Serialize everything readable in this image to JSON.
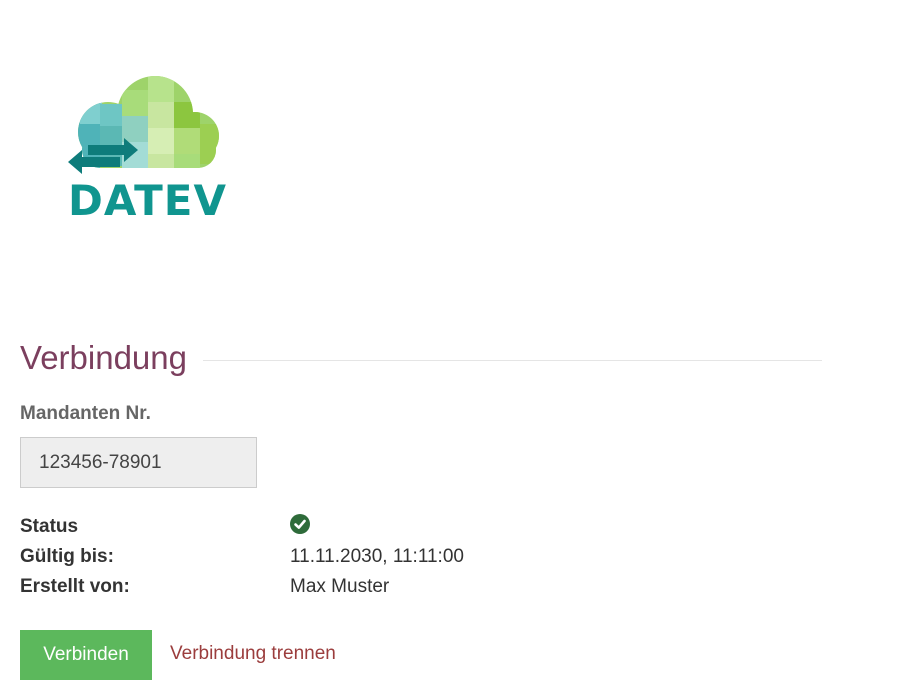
{
  "logo": {
    "text": "DATEV",
    "icon": "cloud-exchange-logo",
    "colors": {
      "teal": "#10958f",
      "light_teal": "#7fcfcf",
      "green": "#8cc63f",
      "light_green": "#c8e6a0"
    }
  },
  "section": {
    "title": "Verbindung"
  },
  "client_number": {
    "label": "Mandanten Nr.",
    "value": "123456-78901"
  },
  "info": {
    "status_label": "Status",
    "status_icon": "check-circle-icon",
    "status_color": "#2e6b3a",
    "valid_until_label": "Gültig bis:",
    "valid_until_value": "11.11.2030, 11:11:00",
    "created_by_label": "Erstellt von:",
    "created_by_value": "Max Muster"
  },
  "actions": {
    "connect_label": "Verbinden",
    "connect_color": "#5cb85c",
    "disconnect_label": "Verbindung trennen",
    "disconnect_color": "#9b3d3d"
  }
}
